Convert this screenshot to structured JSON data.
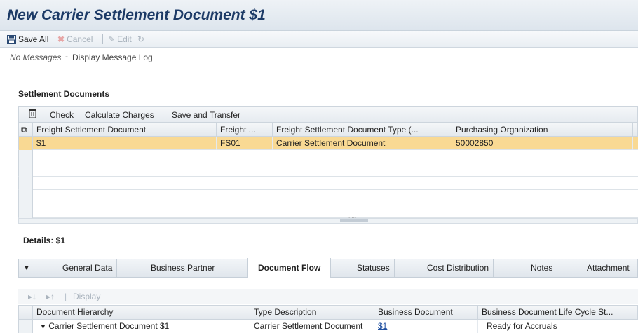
{
  "window": {
    "title": "New Carrier Settlement Document $1"
  },
  "toolbar": {
    "save_all": "Save All",
    "cancel": "Cancel",
    "edit": "Edit"
  },
  "messages": {
    "none": "No Messages",
    "log_link": "Display Message Log"
  },
  "settlement": {
    "section_title": "Settlement Documents",
    "toolbar": {
      "check": "Check",
      "calculate": "Calculate Charges",
      "save_transfer": "Save and Transfer"
    },
    "columns": [
      "Freight Settlement Document",
      "Freight ...",
      "Freight Settlement Document Type (...",
      "Purchasing Organization"
    ],
    "rows": [
      {
        "doc": "$1",
        "type_code": "FS01",
        "type_desc": "Carrier Settlement Document",
        "purch_org": "50002850"
      }
    ],
    "scroll_indicator": "....."
  },
  "details": {
    "section_title": "Details: $1",
    "tabs": [
      {
        "label": "General Data"
      },
      {
        "label": "Business Partner"
      },
      {
        "label": "Document Flow"
      },
      {
        "label": "Statuses"
      },
      {
        "label": "Cost Distribution"
      },
      {
        "label": "Notes"
      },
      {
        "label": "Attachment"
      }
    ],
    "active_tab": "Document Flow"
  },
  "flow": {
    "toolbar": {
      "display": "Display"
    },
    "columns": [
      "Document Hierarchy",
      "Type Description",
      "Business Document",
      "Business Document Life Cycle St..."
    ],
    "rows": [
      {
        "hierarchy": "Carrier Settlement Document $1",
        "type": "Carrier Settlement Document",
        "doc": "$1",
        "status": "Ready for Accruals"
      }
    ]
  },
  "colors": {
    "title": "#1c3a66",
    "selection": "#f9d993",
    "link": "#1f4fa0"
  }
}
